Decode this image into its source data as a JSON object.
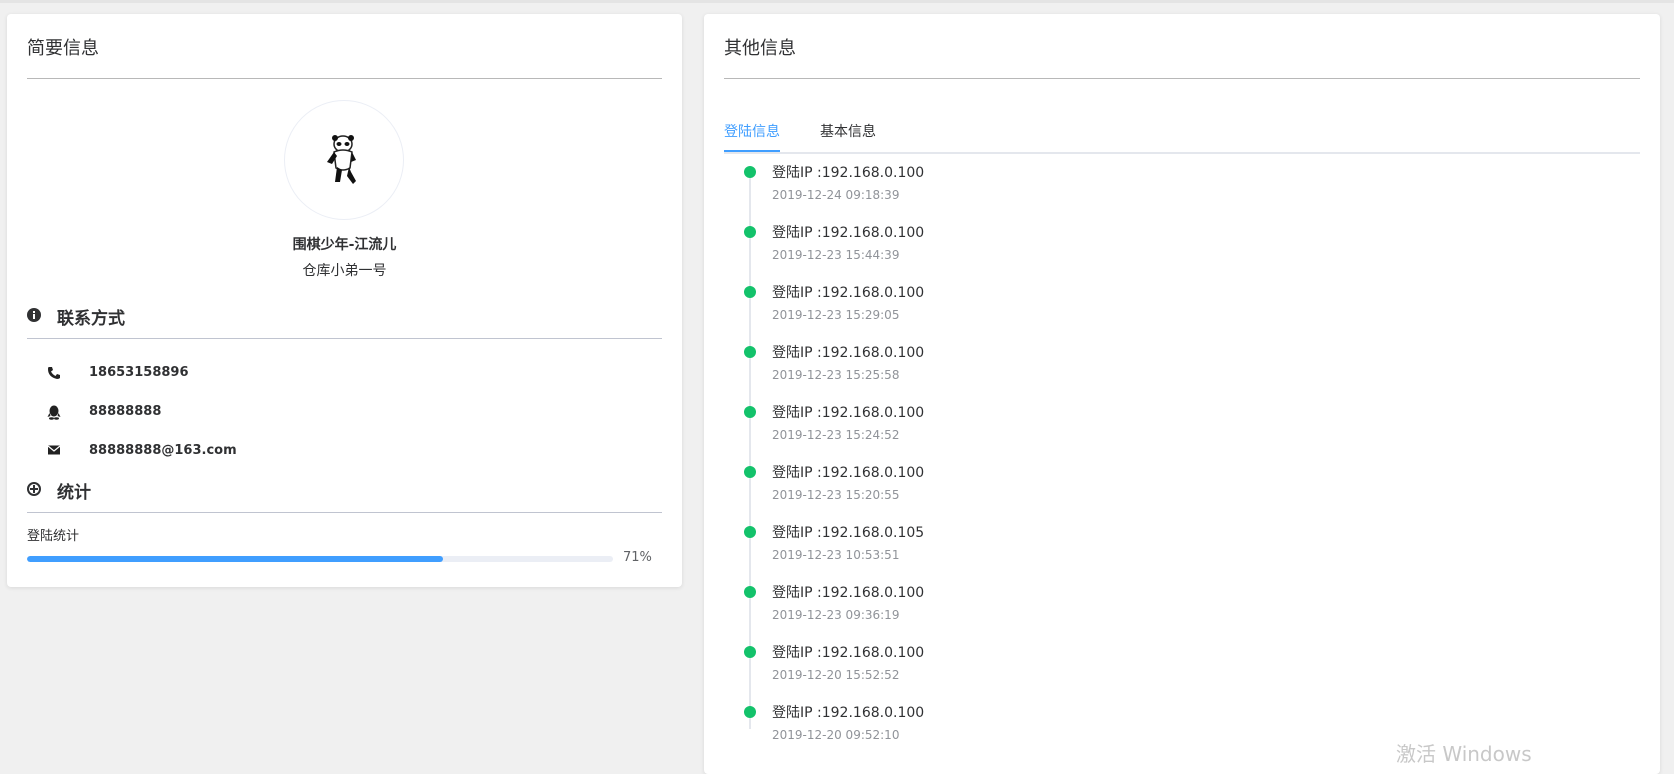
{
  "left_card": {
    "title": "简要信息",
    "user": {
      "name": "围棋少年-江流儿",
      "role": "仓库小弟一号"
    },
    "contact_section": {
      "title": "联系方式",
      "phone": "18653158896",
      "qq": "88888888",
      "email": "88888888@163.com"
    },
    "stats_section": {
      "title": "统计",
      "login_stats_label": "登陆统计",
      "login_stats_percent": 71,
      "login_stats_text": "71%"
    }
  },
  "right_card": {
    "title": "其他信息",
    "tabs": [
      {
        "label": "登陆信息",
        "active": true
      },
      {
        "label": "基本信息",
        "active": false
      }
    ],
    "timeline": [
      {
        "content": "登陆IP :192.168.0.100",
        "time": "2019-12-24 09:18:39"
      },
      {
        "content": "登陆IP :192.168.0.100",
        "time": "2019-12-23 15:44:39"
      },
      {
        "content": "登陆IP :192.168.0.100",
        "time": "2019-12-23 15:29:05"
      },
      {
        "content": "登陆IP :192.168.0.100",
        "time": "2019-12-23 15:25:58"
      },
      {
        "content": "登陆IP :192.168.0.100",
        "time": "2019-12-23 15:24:52"
      },
      {
        "content": "登陆IP :192.168.0.100",
        "time": "2019-12-23 15:20:55"
      },
      {
        "content": "登陆IP :192.168.0.105",
        "time": "2019-12-23 10:53:51"
      },
      {
        "content": "登陆IP :192.168.0.100",
        "time": "2019-12-23 09:36:19"
      },
      {
        "content": "登陆IP :192.168.0.100",
        "time": "2019-12-20 15:52:52"
      },
      {
        "content": "登陆IP :192.168.0.100",
        "time": "2019-12-20 09:52:10"
      }
    ]
  },
  "watermark": "激活 Windows",
  "colors": {
    "accent": "#409eff",
    "timeline_dot": "#13c26b",
    "background": "#f0f0f0"
  },
  "icons": {
    "info": "info-circle-icon",
    "phone": "phone-icon",
    "qq": "qq-icon",
    "email": "mail-icon",
    "stats": "chart-icon"
  }
}
